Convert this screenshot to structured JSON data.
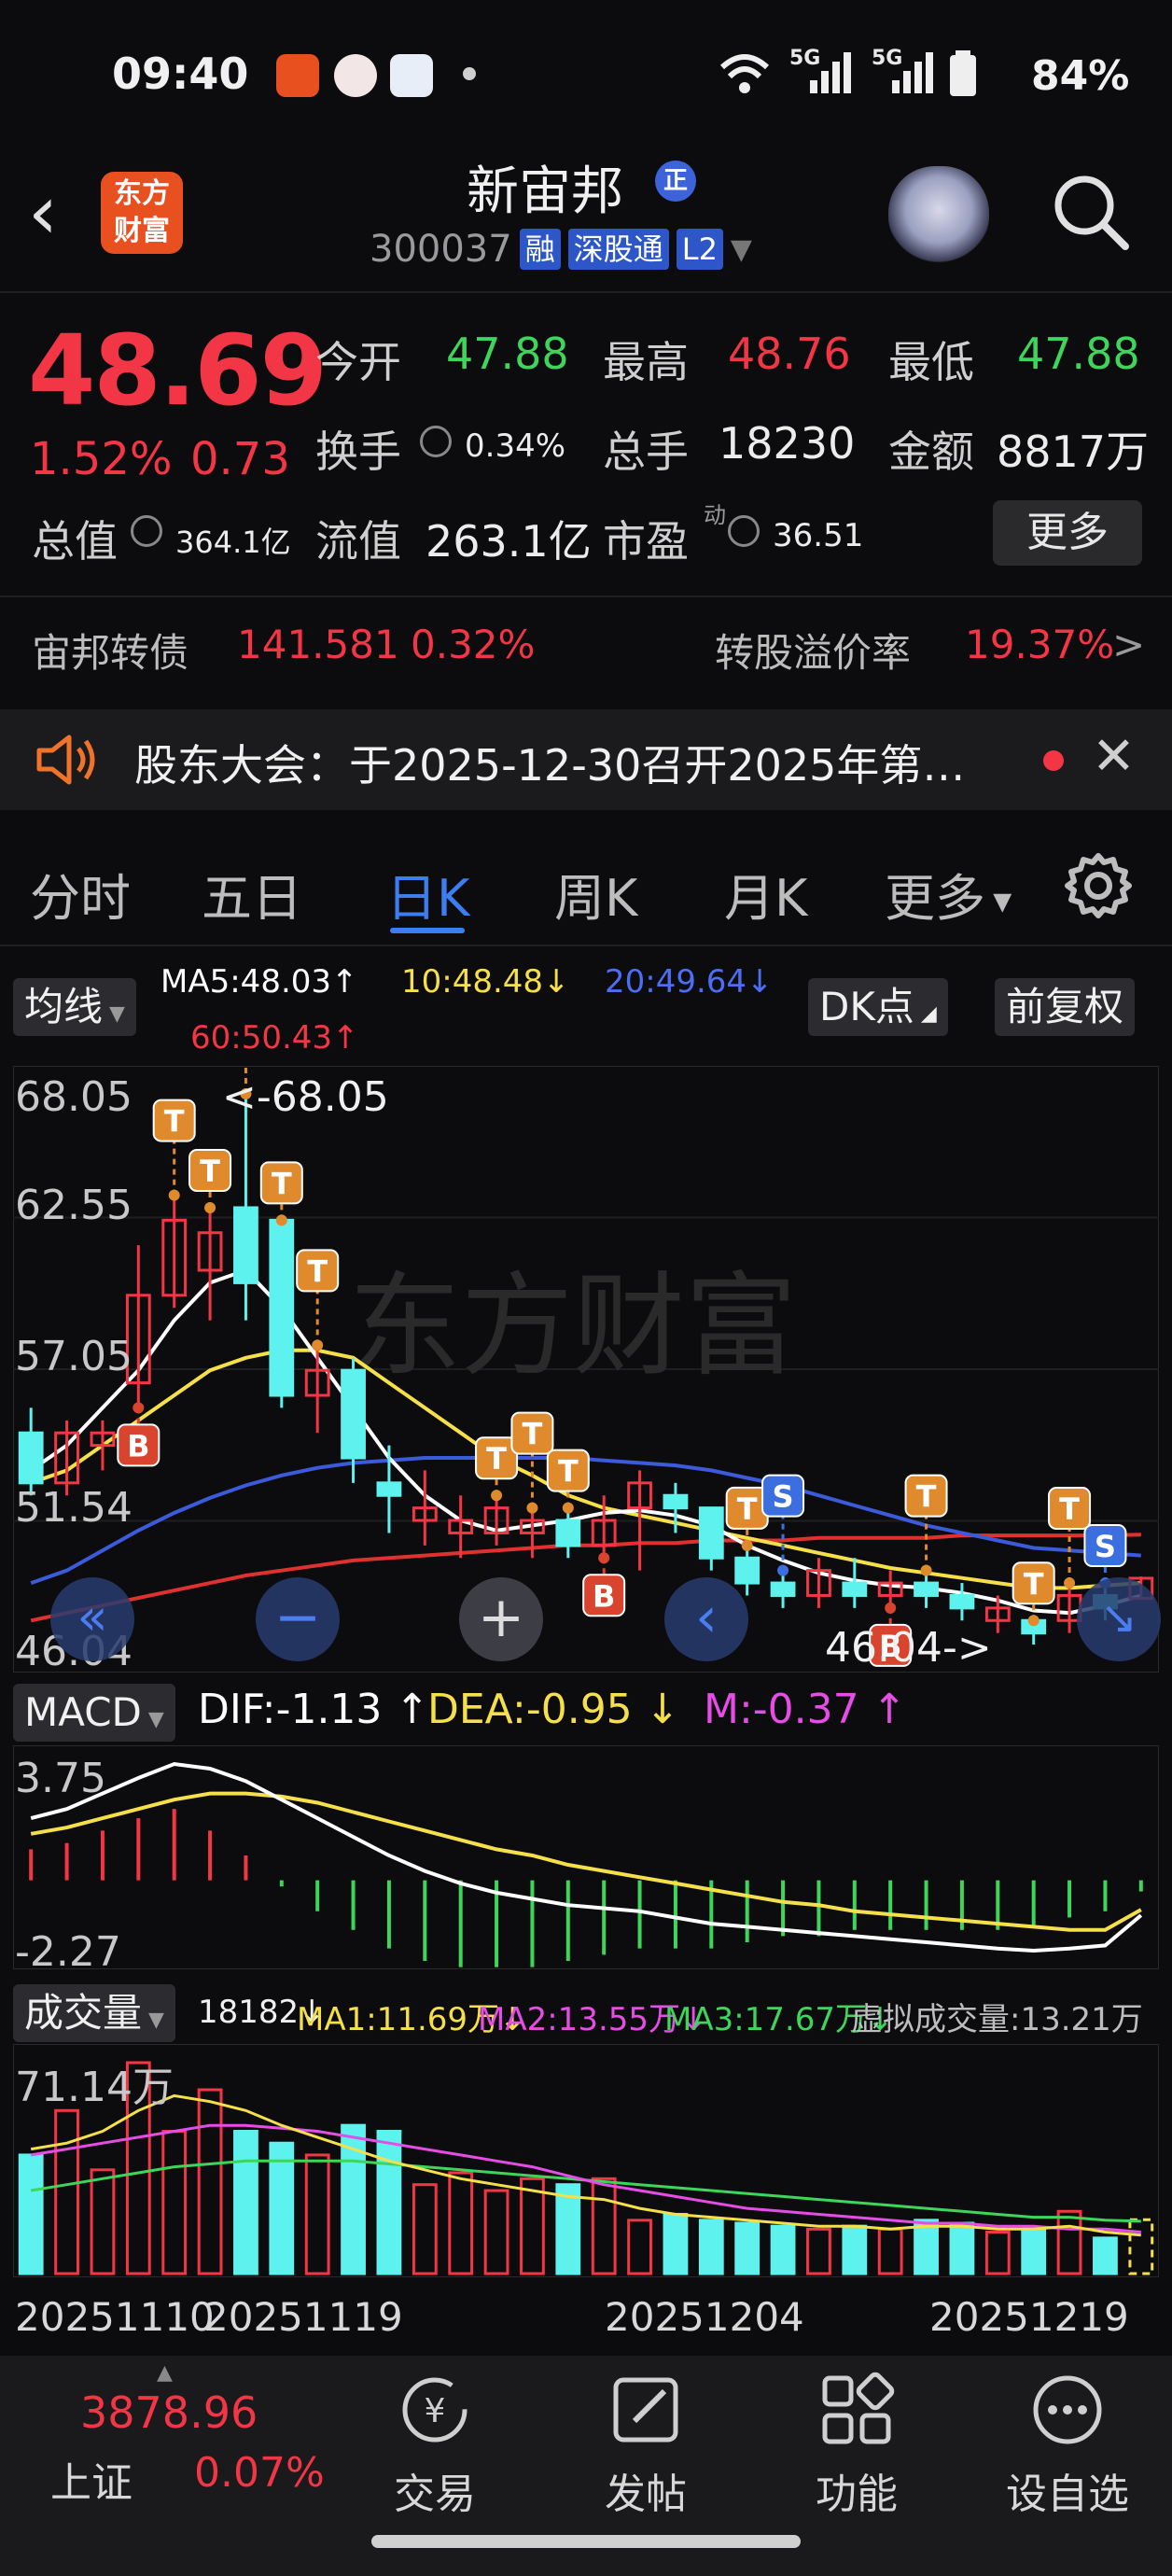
{
  "status_bar": {
    "time": "09:40",
    "battery": "84%",
    "network": [
      "5G",
      "5G"
    ]
  },
  "header": {
    "logo_text": [
      "东方",
      "财富"
    ],
    "stock_name": "新宙邦",
    "badge": "正",
    "code": "300037",
    "tags": [
      "融",
      "深股通",
      "L2"
    ]
  },
  "quote": {
    "price": "48.69",
    "change_pct": "1.52%",
    "change_amt": "0.73",
    "open_label": "今开",
    "open": "47.88",
    "high_label": "最高",
    "high": "48.76",
    "low_label": "最低",
    "low": "47.88",
    "turnover_label": "换手",
    "turnover": "0.34%",
    "volume_label": "总手",
    "volume": "18230",
    "amount_label": "金额",
    "amount": "8817万",
    "mcap_label": "总值",
    "mcap": "364.1亿",
    "float_label": "流值",
    "float_cap": "263.1亿",
    "pe_label": "市盈",
    "pe_sup": "动",
    "pe": "36.51",
    "more": "更多"
  },
  "bond": {
    "name": "宙邦转债",
    "price": "141.581",
    "pct": "0.32%",
    "premium_label": "转股溢价率",
    "premium": "19.37%",
    "arrow": ">"
  },
  "notice": {
    "text": "股东大会：于2025-12-30召开2025年第…"
  },
  "tabs": {
    "items": [
      "分时",
      "五日",
      "日K",
      "周K",
      "月K",
      "更多"
    ],
    "active": "日K"
  },
  "ma_legend": {
    "button": "均线",
    "ma5": "MA5:48.03↑",
    "ma10": "10:48.48↓",
    "ma20": "20:49.64↓",
    "ma60": "60:50.43↑",
    "dk_button": "DK点",
    "adjust_button": "前复权",
    "colors": {
      "ma5": "#ffffff",
      "ma10": "#f5e04a",
      "ma20": "#3b5bdb",
      "ma60": "#e03131"
    }
  },
  "kline_axis": {
    "y_ticks": [
      "68.05",
      "62.55",
      "57.05",
      "51.54",
      "46.04"
    ],
    "max_label": "<-68.05",
    "min_label": "46.04->"
  },
  "macd": {
    "button": "MACD",
    "dif": "DIF:-1.13 ↑",
    "dea": "DEA:-0.95 ↓",
    "m": "M:-0.37 ↑",
    "y_ticks": [
      "3.75",
      "-2.27"
    ]
  },
  "volume": {
    "button": "成交量",
    "current": "18182↓",
    "ma1": "MA1:11.69万↓",
    "ma2": "MA2:13.55万↓",
    "ma3": "MA3:17.67万↓",
    "virtual": "虚拟成交量:13.21万",
    "y_tick": "71.14万",
    "dates": [
      "20251110",
      "20251119",
      "20251204",
      "20251219"
    ]
  },
  "chart_data": {
    "type": "candlestick",
    "ylim": [
      46.04,
      68.05
    ],
    "candles": [
      {
        "o": 54.5,
        "c": 52.5,
        "h": 55.5,
        "l": 52.0
      },
      {
        "o": 52.5,
        "c": 54.5,
        "h": 55.0,
        "l": 52.0
      },
      {
        "o": 54.0,
        "c": 54.5,
        "h": 55.0,
        "l": 53.0
      },
      {
        "o": 56.5,
        "c": 60.0,
        "h": 62.0,
        "l": 55.5
      },
      {
        "o": 60.0,
        "c": 63.0,
        "h": 64.0,
        "l": 59.5
      },
      {
        "o": 61.0,
        "c": 62.5,
        "h": 63.5,
        "l": 59.0
      },
      {
        "o": 63.5,
        "c": 60.5,
        "h": 68.05,
        "l": 59.0
      },
      {
        "o": 63.0,
        "c": 56.0,
        "h": 63.0,
        "l": 55.5
      },
      {
        "o": 56.0,
        "c": 57.0,
        "h": 58.0,
        "l": 54.5
      },
      {
        "o": 57.0,
        "c": 53.5,
        "h": 57.5,
        "l": 52.5
      },
      {
        "o": 52.5,
        "c": 52.0,
        "h": 54.0,
        "l": 50.5
      },
      {
        "o": 51.0,
        "c": 51.5,
        "h": 53.0,
        "l": 50.0
      },
      {
        "o": 50.5,
        "c": 51.0,
        "h": 52.0,
        "l": 49.5
      },
      {
        "o": 50.5,
        "c": 51.5,
        "h": 52.0,
        "l": 50.0
      },
      {
        "o": 50.5,
        "c": 51.0,
        "h": 51.5,
        "l": 49.5
      },
      {
        "o": 51.0,
        "c": 50.0,
        "h": 51.5,
        "l": 49.5
      },
      {
        "o": 50.0,
        "c": 51.0,
        "h": 52.0,
        "l": 49.5
      },
      {
        "o": 51.5,
        "c": 52.5,
        "h": 53.0,
        "l": 49.0
      },
      {
        "o": 52.0,
        "c": 51.5,
        "h": 52.5,
        "l": 50.5
      },
      {
        "o": 51.5,
        "c": 49.5,
        "h": 51.5,
        "l": 49.0
      },
      {
        "o": 49.5,
        "c": 48.5,
        "h": 50.0,
        "l": 48.0
      },
      {
        "o": 48.5,
        "c": 48.0,
        "h": 49.0,
        "l": 47.5
      },
      {
        "o": 48.0,
        "c": 49.0,
        "h": 49.5,
        "l": 47.5
      },
      {
        "o": 48.5,
        "c": 48.0,
        "h": 49.5,
        "l": 47.5
      },
      {
        "o": 48.0,
        "c": 48.5,
        "h": 49.0,
        "l": 47.5
      },
      {
        "o": 48.5,
        "c": 48.0,
        "h": 49.0,
        "l": 47.5
      },
      {
        "o": 48.0,
        "c": 47.5,
        "h": 48.5,
        "l": 47.0
      },
      {
        "o": 47.0,
        "c": 47.5,
        "h": 48.0,
        "l": 46.5
      },
      {
        "o": 47.0,
        "c": 46.5,
        "h": 47.0,
        "l": 46.04
      },
      {
        "o": 47.0,
        "c": 48.0,
        "h": 48.5,
        "l": 46.5
      },
      {
        "o": 48.0,
        "c": 47.5,
        "h": 48.5,
        "l": 47.0
      },
      {
        "o": 47.88,
        "c": 48.69,
        "h": 48.76,
        "l": 47.88
      }
    ],
    "ma5": [
      53.0,
      54.0,
      55.5,
      57.0,
      59.0,
      60.5,
      61.0,
      59.5,
      57.5,
      55.5,
      53.5,
      52.0,
      51.0,
      50.6,
      50.8,
      51.0,
      51.3,
      51.4,
      51.2,
      50.8,
      50.0,
      49.4,
      48.9,
      48.6,
      48.4,
      48.3,
      48.1,
      47.8,
      47.4,
      47.3,
      47.6,
      48.0
    ],
    "ma10": [
      52.5,
      53.0,
      54.0,
      55.0,
      56.0,
      57.0,
      57.5,
      57.8,
      57.8,
      57.5,
      56.5,
      55.5,
      54.5,
      53.5,
      52.8,
      52.0,
      51.5,
      51.2,
      50.9,
      50.6,
      50.3,
      50.0,
      49.7,
      49.4,
      49.1,
      48.9,
      48.7,
      48.5,
      48.3,
      48.3,
      48.4,
      48.5
    ],
    "ma20": [
      48.5,
      49.0,
      49.8,
      50.6,
      51.3,
      51.9,
      52.4,
      52.8,
      53.1,
      53.3,
      53.4,
      53.5,
      53.5,
      53.5,
      53.5,
      53.5,
      53.4,
      53.3,
      53.2,
      53.0,
      52.7,
      52.4,
      52.0,
      51.6,
      51.2,
      50.8,
      50.5,
      50.2,
      49.9,
      49.8,
      49.7,
      49.6
    ],
    "ma60": [
      47.0,
      47.3,
      47.6,
      47.9,
      48.2,
      48.5,
      48.8,
      49.0,
      49.2,
      49.4,
      49.5,
      49.6,
      49.7,
      49.8,
      49.9,
      50.0,
      50.0,
      50.1,
      50.1,
      50.2,
      50.2,
      50.2,
      50.3,
      50.3,
      50.3,
      50.3,
      50.4,
      50.4,
      50.4,
      50.4,
      50.4,
      50.43
    ],
    "signals": [
      {
        "i": 3,
        "t": "B"
      },
      {
        "i": 4,
        "t": "T"
      },
      {
        "i": 5,
        "t": "T"
      },
      {
        "i": 6,
        "t": "T"
      },
      {
        "i": 7,
        "t": "T"
      },
      {
        "i": 8,
        "t": "T"
      },
      {
        "i": 13,
        "t": "T"
      },
      {
        "i": 14,
        "t": "T"
      },
      {
        "i": 15,
        "t": "T"
      },
      {
        "i": 16,
        "t": "B"
      },
      {
        "i": 20,
        "t": "T"
      },
      {
        "i": 21,
        "t": "S"
      },
      {
        "i": 24,
        "t": "B"
      },
      {
        "i": 25,
        "t": "T"
      },
      {
        "i": 28,
        "t": "T"
      },
      {
        "i": 29,
        "t": "T"
      },
      {
        "i": 30,
        "t": "S"
      }
    ],
    "macd_dif": [
      2.0,
      2.3,
      2.8,
      3.3,
      3.75,
      3.6,
      3.2,
      2.6,
      2.0,
      1.4,
      0.8,
      0.3,
      -0.1,
      -0.4,
      -0.6,
      -0.8,
      -0.9,
      -1.0,
      -1.2,
      -1.4,
      -1.5,
      -1.6,
      -1.7,
      -1.8,
      -1.9,
      -2.0,
      -2.1,
      -2.2,
      -2.27,
      -2.2,
      -2.1,
      -1.13
    ],
    "macd_dea": [
      1.5,
      1.7,
      2.0,
      2.3,
      2.6,
      2.8,
      2.8,
      2.7,
      2.5,
      2.2,
      1.9,
      1.6,
      1.3,
      1.0,
      0.8,
      0.5,
      0.3,
      0.1,
      -0.1,
      -0.3,
      -0.5,
      -0.7,
      -0.8,
      -1.0,
      -1.1,
      -1.2,
      -1.3,
      -1.4,
      -1.5,
      -1.6,
      -1.6,
      -0.95
    ],
    "volumes": [
      40,
      55,
      35,
      71.14,
      48,
      62,
      48,
      44,
      40,
      50,
      48,
      30,
      34,
      28,
      32,
      30,
      32,
      18,
      20,
      18,
      17,
      16,
      15,
      16,
      15,
      18,
      17,
      14,
      15,
      21,
      12,
      18.18
    ],
    "vol_ma1": [
      42,
      44,
      48,
      55,
      60,
      58,
      55,
      50,
      46,
      42,
      38,
      35,
      32,
      30,
      28,
      26,
      25,
      22,
      20,
      19,
      18,
      17,
      16,
      16,
      15,
      16,
      16,
      15,
      15,
      16,
      14,
      13
    ],
    "vol_ma2": [
      40,
      42,
      44,
      46,
      48,
      50,
      50,
      49,
      48,
      46,
      44,
      42,
      40,
      38,
      36,
      33,
      30,
      28,
      26,
      24,
      22,
      21,
      20,
      19,
      18,
      17,
      17,
      16,
      16,
      15,
      15,
      14
    ],
    "vol_ma3": [
      28,
      30,
      32,
      34,
      36,
      37,
      38,
      38,
      38,
      38,
      37,
      36,
      35,
      34,
      33,
      32,
      31,
      30,
      29,
      28,
      27,
      26,
      25,
      24,
      23,
      22,
      21,
      20,
      19,
      19,
      18,
      17.67
    ]
  },
  "bottom_nav": {
    "index_value": "3878.96",
    "index_name": "上证",
    "index_pct": "0.07%",
    "items": [
      "交易",
      "发帖",
      "功能",
      "设自选"
    ]
  }
}
